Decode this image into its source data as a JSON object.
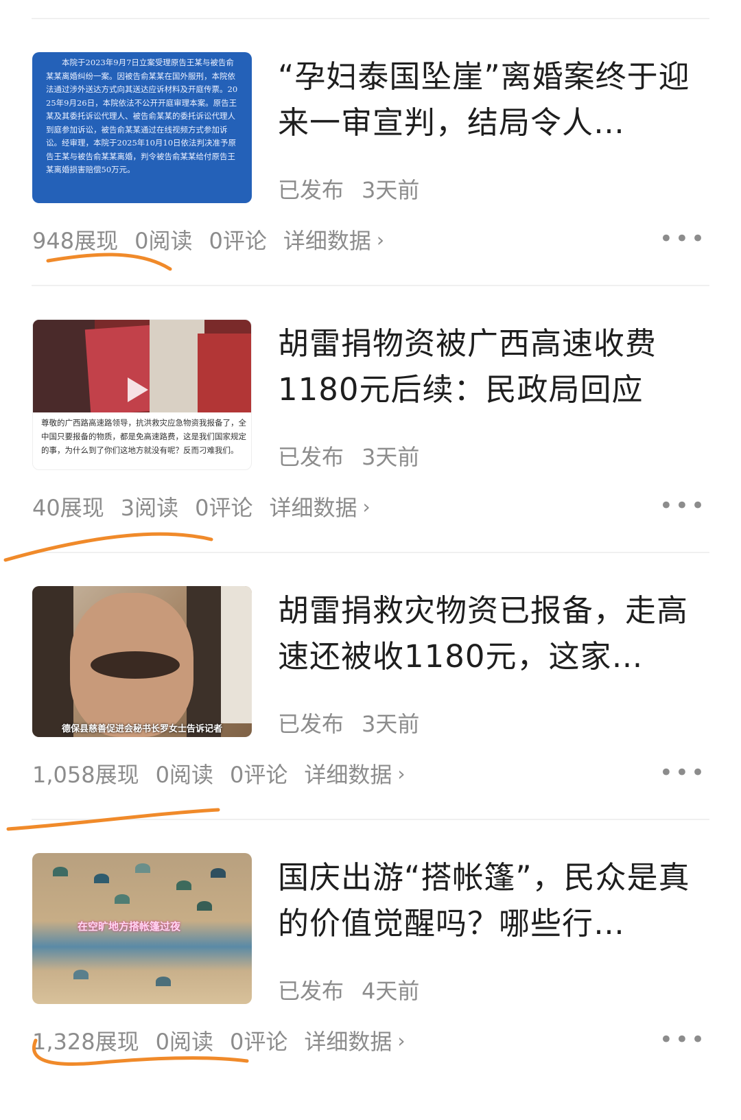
{
  "articles": [
    {
      "title": "“孕妇泰国坠崖”离婚案终于迎来一审宣判，结局令人…",
      "status": "已发布",
      "time": "3天前",
      "impressions": "948展现",
      "reads": "0阅读",
      "comments": "0评论",
      "detail_label": "详细数据",
      "thumbnail_text": "本院于2023年9月7日立案受理原告王某与被告俞某某离婚纠纷一案。因被告俞某某在国外服刑，本院依法通过涉外送达方式向其送达应诉材料及开庭传票。2025年9月26日，本院依法不公开开庭审理本案。原告王某及其委托诉讼代理人、被告俞某某的委托诉讼代理人到庭参加诉讼，被告俞某某通过在线视频方式参加诉讼。经审理，本院于2025年10月10日依法判决准予原告王某与被告俞某某离婚，判令被告俞某某给付原告王某离婚损害赔偿50万元。"
    },
    {
      "title": "胡雷捐物资被广西高速收费1180元后续：民政局回应",
      "status": "已发布",
      "time": "3天前",
      "impressions": "40展现",
      "reads": "3阅读",
      "comments": "0评论",
      "detail_label": "详细数据",
      "thumbnail_text": "尊敬的广西路高速路领导，抗洪救灾应急物资我报备了，全中国只要报备的物质，都是免高速路费，这是我们国家规定的事，为什么到了你们这地方就没有呢？反而刁难我们。"
    },
    {
      "title": "胡雷捐救灾物资已报备，走高速还被收1180元，这家…",
      "status": "已发布",
      "time": "3天前",
      "impressions": "1,058展现",
      "reads": "0阅读",
      "comments": "0评论",
      "detail_label": "详细数据",
      "thumbnail_text": "德保县慈善促进会秘书长罗女士告诉记者"
    },
    {
      "title": "国庆出游“搭帐篷”，民众是真的价值觉醒吗？哪些行…",
      "status": "已发布",
      "time": "4天前",
      "impressions": "1,328展现",
      "reads": "0阅读",
      "comments": "0评论",
      "detail_label": "详细数据",
      "thumbnail_text": "在空旷地方搭帐篷过夜"
    }
  ],
  "icons": {
    "more": "more-dots-icon",
    "chevron": "chevron-right-icon"
  },
  "colors": {
    "highlight": "#f08a2a",
    "muted": "#8c8c8c",
    "doc_blue": "#2461b8"
  }
}
